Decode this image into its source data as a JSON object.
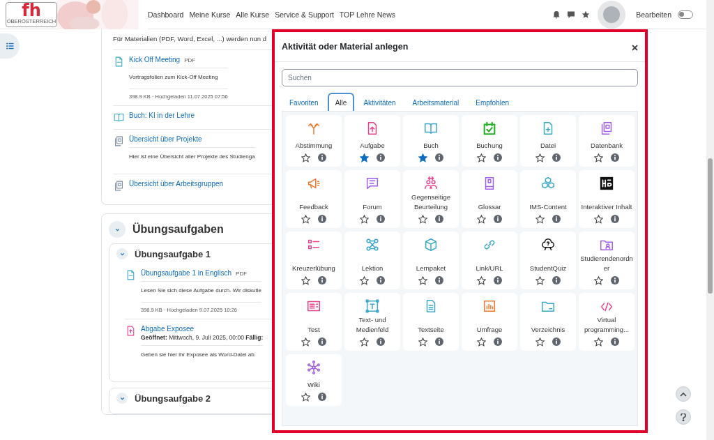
{
  "header": {
    "logo": {
      "letters": "fh",
      "subtitle": "OBERÖSTERREICH"
    },
    "nav": [
      "Dashboard",
      "Meine Kurse",
      "Alle Kurse",
      "Service & Support",
      "TOP Lehre News"
    ],
    "edit_mode": {
      "label": "Bearbeiten",
      "on": false
    }
  },
  "course": {
    "intro": "Für Materialien (PDF, Word, Excel, ...) werden nun d",
    "items": [
      {
        "kind": "file",
        "title": "Kick Off Meeting",
        "badge": "PDF",
        "description": "Vortragsfolien zum Kick-Off Meeting",
        "meta": "398.9 KB · Hochgeladen 11.07.2025 07:56"
      },
      {
        "kind": "book",
        "title": "Buch: KI in der Lehre"
      },
      {
        "kind": "page",
        "title": "Übersicht über Projekte",
        "description": "Hier ist eine Übersicht aller Projekte des Studienga"
      },
      {
        "kind": "page",
        "title": "Übersicht über Arbeitsgruppen"
      }
    ],
    "section": {
      "title": "Übungsaufgaben",
      "expanded": true,
      "subsections": [
        {
          "title": "Übungsaufgabe 1",
          "expanded": true,
          "items": [
            {
              "kind": "file",
              "title": "Übungsaufgabe 1 in Englisch",
              "badge": "PDF",
              "description": "Lesen Sie sich diese Aufgabe durch. Wir diskutie",
              "meta": "398.9 KB · Hochgeladen 9.07.2025 10:26"
            },
            {
              "kind": "assignment",
              "title": "Abgabe Exposee",
              "dates": "**Geöffnet:** Mittwoch, 9. Juli 2025, 00:00   **Fällig:**",
              "description": "Geben sie hier ihr Exposee als Word-Datei ab."
            }
          ]
        },
        {
          "title": "Übungsaufgabe 2",
          "expanded": true
        }
      ]
    }
  },
  "modal": {
    "title": "Aktivität oder Material anlegen",
    "search": {
      "placeholder": "Suchen"
    },
    "tabs": [
      {
        "label": "Favoriten",
        "selected": false
      },
      {
        "label": "Alle",
        "selected": true
      },
      {
        "label": "Aktivitäten",
        "selected": false
      },
      {
        "label": "Arbeitsmaterial",
        "selected": false
      },
      {
        "label": "Empfohlen",
        "selected": false
      }
    ],
    "items": [
      {
        "name": "Abstimmung",
        "color": "#f0762b",
        "starred": false
      },
      {
        "name": "Aufgabe",
        "color": "#e83e8c",
        "starred": true
      },
      {
        "name": "Buch",
        "color": "#38a8c5",
        "starred": true
      },
      {
        "name": "Buchung",
        "color": "#1fae1f",
        "starred": false
      },
      {
        "name": "Datei",
        "color": "#38a8c5",
        "starred": false
      },
      {
        "name": "Datenbank",
        "color": "#a05ee8",
        "starred": false
      },
      {
        "name": "Feedback",
        "color": "#f0762b",
        "starred": false
      },
      {
        "name": "Forum",
        "color": "#a05ee8",
        "starred": false
      },
      {
        "name": "Gegenseitige Beurteilung",
        "color": "#e83e8c",
        "starred": false
      },
      {
        "name": "Glossar",
        "color": "#a05ee8",
        "starred": false
      },
      {
        "name": "IMS-Content",
        "color": "#38a8c5",
        "starred": false
      },
      {
        "name": "Interaktiver Inhalt",
        "color": "#111111",
        "starred": false
      },
      {
        "name": "Kreuzerlübung",
        "color": "#e83e8c",
        "starred": false
      },
      {
        "name": "Lektion",
        "color": "#38a8c5",
        "starred": false
      },
      {
        "name": "Lernpaket",
        "color": "#38a8c5",
        "starred": false
      },
      {
        "name": "Link/URL",
        "color": "#38a8c5",
        "starred": false
      },
      {
        "name": "StudentQuiz",
        "color": "#111111",
        "starred": false
      },
      {
        "name": "Studierendenordner",
        "color": "#a05ee8",
        "starred": false
      },
      {
        "name": "Test",
        "color": "#e83e8c",
        "starred": false
      },
      {
        "name": "Text- und Medienfeld",
        "color": "#38a8c5",
        "starred": false
      },
      {
        "name": "Textseite",
        "color": "#38a8c5",
        "starred": false
      },
      {
        "name": "Umfrage",
        "color": "#f0762b",
        "starred": false
      },
      {
        "name": "Verzeichnis",
        "color": "#38a8c5",
        "starred": false
      },
      {
        "name": "Virtual programming...",
        "color": "#e83e8c",
        "starred": false
      },
      {
        "name": "Wiki",
        "color": "#a05ee8",
        "starred": false
      }
    ]
  }
}
